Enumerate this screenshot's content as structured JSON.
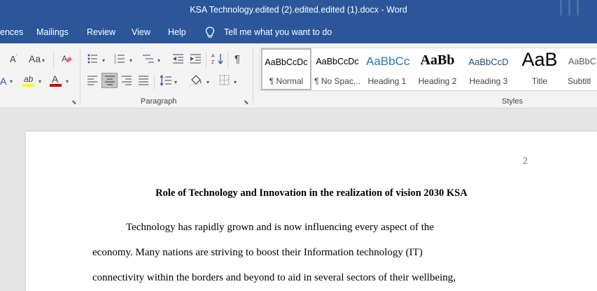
{
  "window": {
    "title": "KSA Technology.edited (2).edited.edited (1).docx  -  Word"
  },
  "menu": {
    "tabs": [
      "ences",
      "Mailings",
      "Review",
      "View",
      "Help"
    ],
    "tell_me": "Tell me what you want to do"
  },
  "ribbon": {
    "font_group": {
      "change_case": "Aa",
      "highlight_label": "ab",
      "font_color_label": "A"
    },
    "paragraph_group": {
      "label": "Paragraph"
    },
    "styles_group": {
      "label": "Styles",
      "items": [
        {
          "preview": "AaBbCcDc",
          "name": "¶ Normal"
        },
        {
          "preview": "AaBbCcDc",
          "name": "¶ No Spac..."
        },
        {
          "preview": "AaBbCc",
          "name": "Heading 1"
        },
        {
          "preview": "AaBb",
          "name": "Heading 2"
        },
        {
          "preview": "AaBbCcD",
          "name": "Heading 3"
        },
        {
          "preview": "AaB",
          "name": "Title"
        },
        {
          "preview": "AaBbC",
          "name": "Subtitl"
        }
      ]
    }
  },
  "document": {
    "page_number": "2",
    "heading": "Role of Technology and Innovation in the realization of vision 2030 KSA",
    "lines": [
      "Technology has rapidly grown and is now influencing every aspect of the",
      "economy. Many nations are striving to boost their Information technology (IT)",
      "connectivity within the borders and beyond to aid in several sectors of their wellbeing,"
    ]
  },
  "colors": {
    "title_bar": "#2b579a",
    "ribbon": "#f3f3f3",
    "heading1": "#2e74b5",
    "font_color_bar": "#c00000",
    "highlight_bar": "#ffff00"
  }
}
